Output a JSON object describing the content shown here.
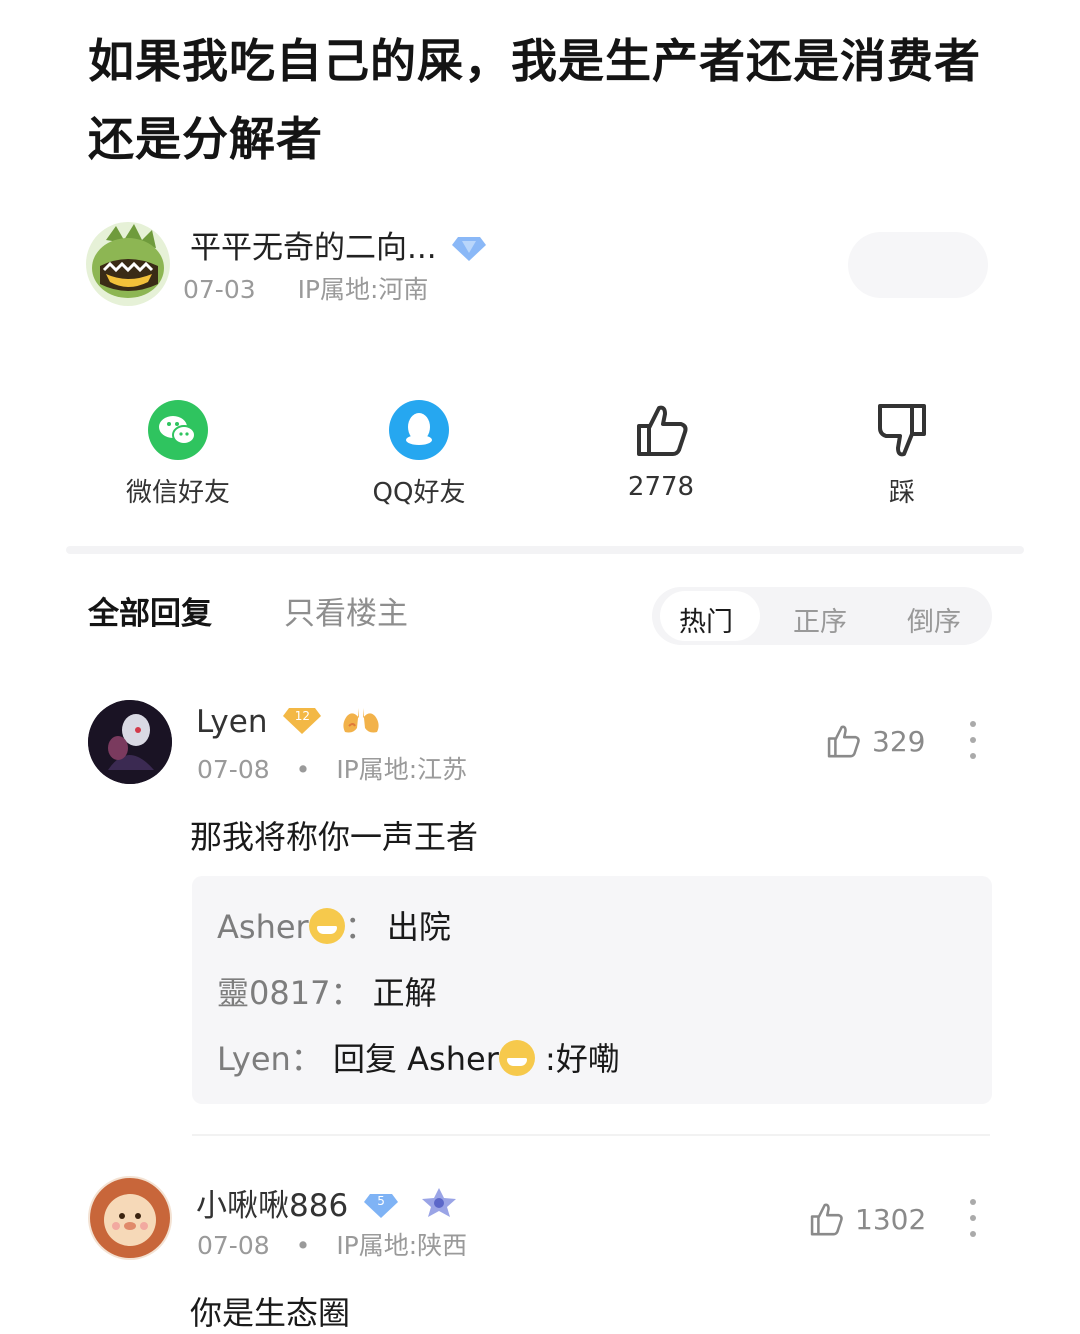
{
  "post": {
    "title": "如果我吃自己的屎，我是生产者还是消费者还是分解者",
    "author": "平平无奇的二向...",
    "date": "07-03",
    "ip": "IP属地:河南"
  },
  "actions": {
    "wechat_label": "微信好友",
    "qq_label": "QQ好友",
    "like_count": "2778",
    "dislike_label": "踩"
  },
  "tabs": {
    "all": "全部回复",
    "owner_only": "只看楼主",
    "sort": [
      "热门",
      "正序",
      "倒序"
    ]
  },
  "comments": [
    {
      "name": "Lyen",
      "level_badge": "12",
      "date": "07-08",
      "dot": "•",
      "ip": "IP属地:江苏",
      "likes": "329",
      "text": "那我将称你一声王者",
      "replies": [
        {
          "who": "Asher",
          "colon": "：",
          "text": "出院"
        },
        {
          "who": "靈0817",
          "colon": "：",
          "text": "正解"
        },
        {
          "who": "Lyen",
          "colon": "：",
          "prefix": "回复 Asher",
          "text": ":好嘞"
        }
      ]
    },
    {
      "name": "小啾啾886",
      "level_badge": "5",
      "date": "07-08",
      "dot": "•",
      "ip": "IP属地:陕西",
      "likes": "1302",
      "text": "你是生态圈"
    }
  ],
  "colors": {
    "wechat_green": "#2fc45f",
    "qq_blue": "#26a7f0",
    "badge_blue": "#7fb3f5",
    "badge_gold": "#f3b845"
  }
}
